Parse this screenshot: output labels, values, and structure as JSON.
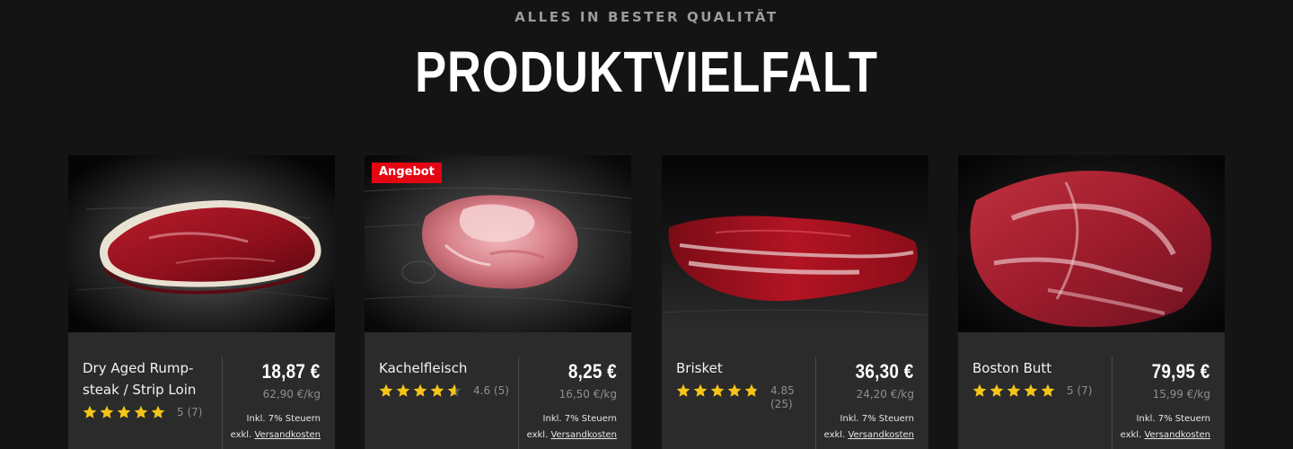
{
  "section": {
    "eyebrow": "ALLES IN BESTER QUALITÄT",
    "title": "PRODUKTVIELFALT"
  },
  "colors": {
    "background": "#141414",
    "card": "#2b2b2b",
    "badge": "#e30613",
    "star": "#f5c518"
  },
  "products": [
    {
      "name": "Dry Aged Rump-steak / Strip Loin",
      "price": "18,87 €",
      "unit_price": "62,90 €/kg",
      "rating": 5,
      "rating_label": "5 (7)",
      "tax": "Inkl. 7% Steuern",
      "shipping_prefix": "exkl.",
      "shipping_link": "Versandkosten",
      "badge": "",
      "image_icon": "rump-steak-image"
    },
    {
      "name": "Kachelfleisch",
      "price": "8,25 €",
      "unit_price": "16,50 €/kg",
      "rating": 4.6,
      "rating_label": "4.6 (5)",
      "tax": "Inkl. 7% Steuern",
      "shipping_prefix": "exkl.",
      "shipping_link": "Versandkosten",
      "badge": "Angebot",
      "image_icon": "kachelfleisch-image"
    },
    {
      "name": "Brisket",
      "price": "36,30 €",
      "unit_price": "24,20 €/kg",
      "rating": 4.85,
      "rating_label": "4.85 (25)",
      "tax": "Inkl. 7% Steuern",
      "shipping_prefix": "exkl.",
      "shipping_link": "Versandkosten",
      "badge": "",
      "image_icon": "brisket-image"
    },
    {
      "name": "Boston Butt",
      "price": "79,95 €",
      "unit_price": "15,99 €/kg",
      "rating": 5,
      "rating_label": "5 (7)",
      "tax": "Inkl. 7% Steuern",
      "shipping_prefix": "exkl.",
      "shipping_link": "Versandkosten",
      "badge": "",
      "image_icon": "boston-butt-image"
    }
  ]
}
